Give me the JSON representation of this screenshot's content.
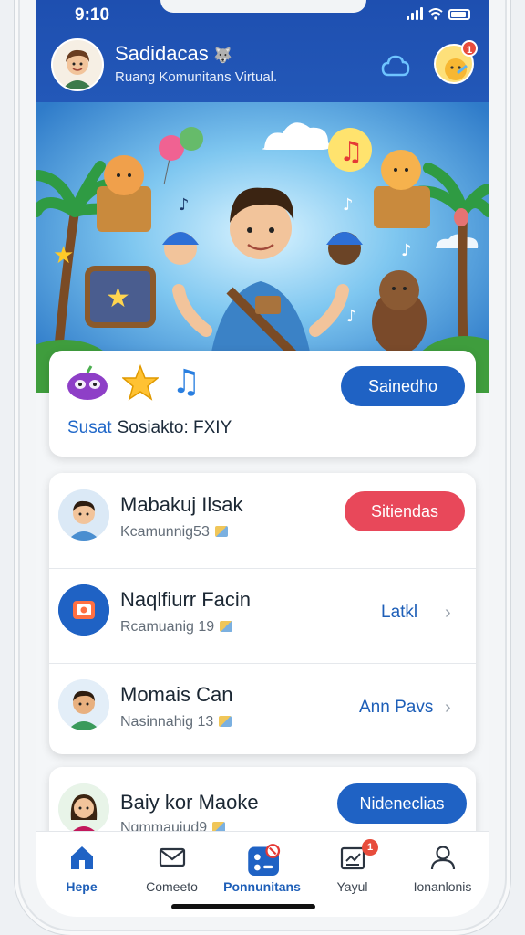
{
  "status": {
    "time": "9:10"
  },
  "header": {
    "title": "Sadidacas",
    "subtitle": "Ruang Komunitans Virtual.",
    "notification_count": "1"
  },
  "feature": {
    "accent": "Susat",
    "text": "Sosiakto: FXIY",
    "button": "Sainedho"
  },
  "list": [
    {
      "name": "Mabakuj Ilsak",
      "meta": "Kcamunnig53",
      "action": "Sitiendas",
      "action_type": "button"
    },
    {
      "name": "Naqlfiurr Facin",
      "meta": "Rcamuanig 19",
      "action": "Latkl",
      "action_type": "link"
    },
    {
      "name": "Momais Can",
      "meta": "Nasinnahig 13",
      "action": "Ann Pavs",
      "action_type": "link"
    }
  ],
  "last": {
    "name": "Baiy kor Maoke",
    "meta": "Nqmmauiud9",
    "action": "Nideneclias"
  },
  "tabs": [
    {
      "label": "Hepe",
      "icon": "home-icon",
      "active": true
    },
    {
      "label": "Comeeto",
      "icon": "mail-icon",
      "active": false
    },
    {
      "label": "Ponnunitans",
      "icon": "community-icon",
      "active": false
    },
    {
      "label": "Yayul",
      "icon": "inbox-icon",
      "active": false,
      "badge": "1"
    },
    {
      "label": "Ionanlonis",
      "icon": "profile-icon",
      "active": false
    }
  ],
  "colors": {
    "primary": "#1f62c4",
    "header": "#2358b8",
    "danger": "#e8485a"
  }
}
